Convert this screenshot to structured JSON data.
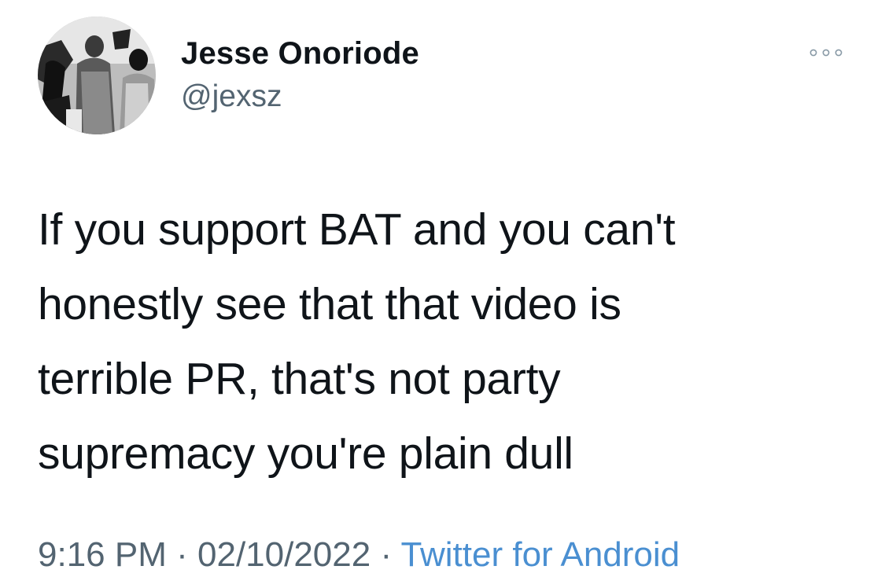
{
  "author": {
    "display_name": "Jesse Onoriode",
    "handle": "@jexsz",
    "avatar_icon": "profile-photo-monochrome"
  },
  "tweet": {
    "lines": [
      "If you support BAT and you can't",
      "honestly see that that video is",
      "terrible PR, that's not party",
      "supremacy you're plain dull"
    ]
  },
  "meta": {
    "time": "9:16 PM",
    "separator": "·",
    "date": "02/10/2022",
    "source": "Twitter for Android"
  },
  "icons": {
    "more": "more-options-icon"
  },
  "colors": {
    "text_primary": "#0f1419",
    "text_secondary": "#536471",
    "link": "#4a8fd1"
  }
}
